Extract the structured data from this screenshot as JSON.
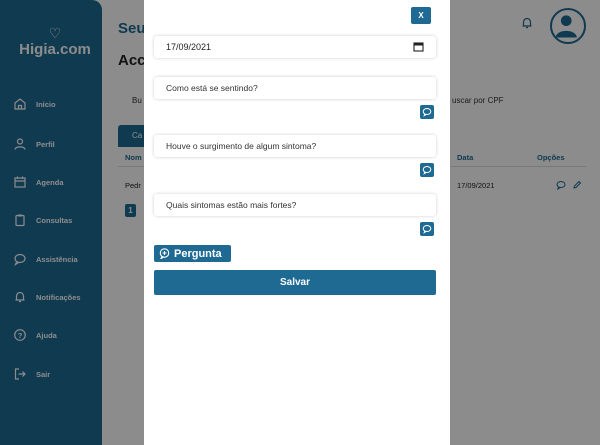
{
  "app": {
    "logo_text": "Higia.com",
    "logo_mark": "♡"
  },
  "sidebar": {
    "items": [
      {
        "label": "Início",
        "icon": "home-icon"
      },
      {
        "label": "Perfil",
        "icon": "user-icon"
      },
      {
        "label": "Agenda",
        "icon": "calendar-icon"
      },
      {
        "label": "Consultas",
        "icon": "clipboard-icon"
      },
      {
        "label": "Assistência",
        "icon": "chat-icon"
      },
      {
        "label": "Notificações",
        "icon": "bell-icon"
      },
      {
        "label": "Ajuda",
        "icon": "help-icon"
      },
      {
        "label": "Sair",
        "icon": "logout-icon"
      }
    ]
  },
  "main": {
    "title_partial": "Seu",
    "subtitle_partial": "Acc",
    "search_left_partial": "Bu",
    "search_cpf_partial": "uscar por CPF",
    "tab_partial": "Ca",
    "table": {
      "headers": {
        "name_partial": "Nom",
        "date": "Data",
        "options": "Opções"
      },
      "rows": [
        {
          "name_partial": "Pedr",
          "date": "17/09/2021"
        }
      ]
    },
    "page": "1"
  },
  "modal": {
    "close_label": "X",
    "date_value": "17/09/2021",
    "questions": [
      "Como está se sentindo?",
      "Houve o surgimento de algum sintoma?",
      "Quais sintomas estão mais fortes?"
    ],
    "add_question_label": "Pergunta",
    "save_label": "Salvar"
  },
  "colors": {
    "brand": "#1e6a93",
    "overlay": "rgba(0,0,0,0.45)"
  }
}
